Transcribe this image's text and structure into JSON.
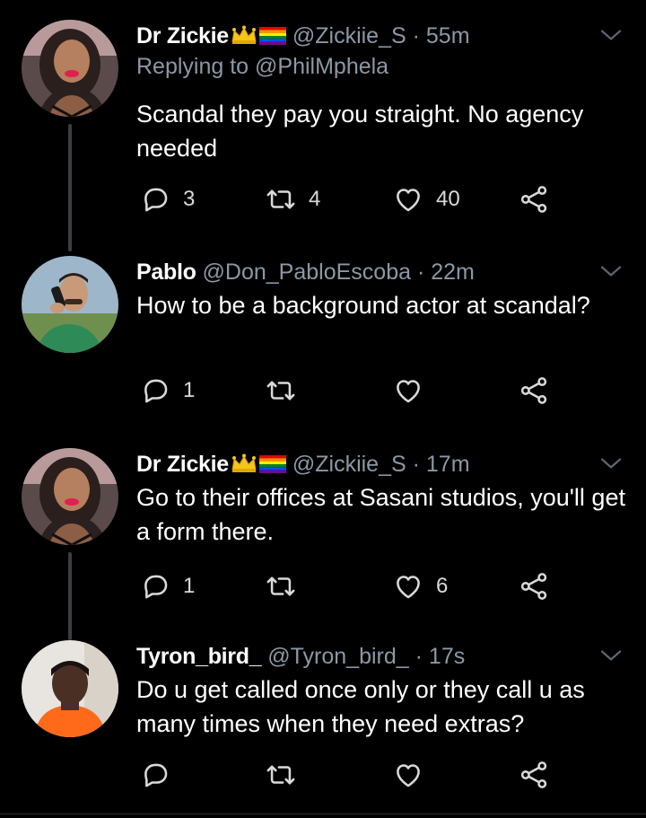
{
  "tweets": [
    {
      "name": "Dr Zickie",
      "handle": "@Zickiie_S",
      "time": "55m",
      "replying_to": "Replying to @PhilMphela",
      "text": "Scandal they pay you straight. No agency needed",
      "replies": "3",
      "retweets": "4",
      "likes": "40",
      "avatar": "woman-portrait"
    },
    {
      "name": "Pablo",
      "handle": "@Don_PabloEscoba",
      "time": "22m",
      "text": "How to be a background actor at scandal?",
      "replies": "1",
      "retweets": "",
      "likes": "",
      "avatar": "man-on-phone-portrait"
    },
    {
      "name": "Dr Zickie",
      "handle": "@Zickiie_S",
      "time": "17m",
      "text": "Go to their offices at Sasani studios, you'll get a form there.",
      "replies": "1",
      "retweets": "",
      "likes": "6",
      "avatar": "woman-portrait"
    },
    {
      "name": "Tyron_bird_",
      "handle": "@Tyron_bird_",
      "time": "17s",
      "text": "Do u get called once only or they call u as many times when they need extras?",
      "replies": "",
      "retweets": "",
      "likes": "",
      "avatar": "young-man-orange-hoodie"
    }
  ],
  "separator": "·",
  "colors": {
    "background": "#000000",
    "text": "#ffffff",
    "secondary": "#8b98a5",
    "thread_line": "#3a3d40"
  },
  "icons": [
    "reply-icon",
    "retweet-icon",
    "like-icon",
    "share-icon",
    "chevron-down-icon",
    "crown-icon",
    "rainbow-flag-icon"
  ]
}
